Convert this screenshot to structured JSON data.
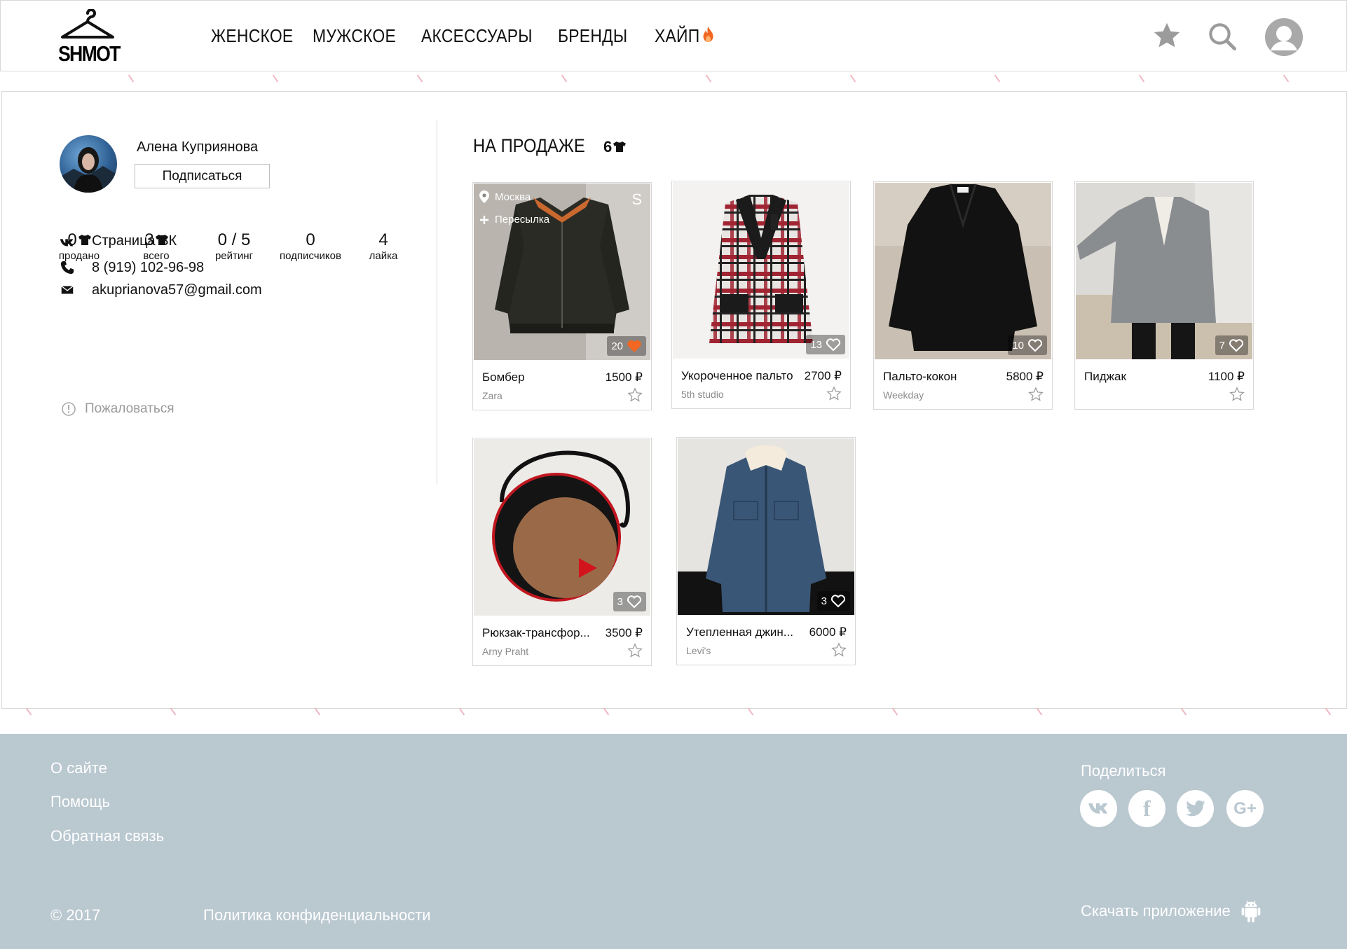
{
  "header": {
    "logo_text": "SHMOT",
    "nav": [
      {
        "label": "ЖЕНСКОЕ"
      },
      {
        "label": "МУЖСКОЕ"
      },
      {
        "label": "АКСЕССУАРЫ"
      },
      {
        "label": "БРЕНДЫ"
      },
      {
        "label": "ХАЙП"
      }
    ],
    "icons": [
      "star-icon",
      "search-icon",
      "user-avatar-icon"
    ]
  },
  "profile": {
    "name": "Алена Куприянова",
    "follow_label": "Подписаться",
    "stats": [
      {
        "value": "0",
        "label": "продано",
        "icon": "tshirt-icon"
      },
      {
        "value": "3",
        "label": "всего",
        "icon": "tshirt-icon"
      },
      {
        "value": "0 / 5",
        "label": "рейтинг"
      },
      {
        "value": "0",
        "label": "подписчиков"
      },
      {
        "value": "4",
        "label": "лайка"
      }
    ],
    "contacts": {
      "vk": "Страница ВК",
      "phone": "8 (919) 102-96-98",
      "email": "akuprianova57@gmail.com"
    },
    "report_label": "Пожаловаться"
  },
  "sale": {
    "title": "НА ПРОДАЖЕ",
    "count": "6",
    "items": [
      {
        "name": "Бомбер",
        "price": "1500 ₽",
        "brand": "Zara",
        "likes": "20",
        "liked": true,
        "city": "Москва",
        "shipping": "Пересылка",
        "size": "S"
      },
      {
        "name": "Укороченное пальто",
        "price": "2700 ₽",
        "brand": "5th studio",
        "likes": "13",
        "liked": false
      },
      {
        "name": "Пальто-кокон",
        "price": "5800 ₽",
        "brand": "Weekday",
        "likes": "10",
        "liked": false
      },
      {
        "name": "Пиджак",
        "price": "1100 ₽",
        "brand": "",
        "likes": "7",
        "liked": false
      },
      {
        "name": "Рюкзак-трансфор...",
        "price": "3500 ₽",
        "brand": "Arny Praht",
        "likes": "3",
        "liked": false
      },
      {
        "name": "Утепленная джин...",
        "price": "6000 ₽",
        "brand": "Levi's",
        "likes": "3",
        "liked": false
      }
    ]
  },
  "footer": {
    "links": [
      "О сайте",
      "Помощь",
      "Обратная связь"
    ],
    "share_title": "Поделиться",
    "social": [
      "vk-icon",
      "facebook-icon",
      "twitter-icon",
      "google-plus-icon"
    ],
    "copyright": "© 2017",
    "privacy": "Политика конфиденциальности",
    "app_download": "Скачать приложение"
  },
  "colors": {
    "accent": "#f26722",
    "footer_bg": "#bac8d0",
    "border": "#d8d8d8",
    "band_stripe": "#f0b7c0"
  }
}
